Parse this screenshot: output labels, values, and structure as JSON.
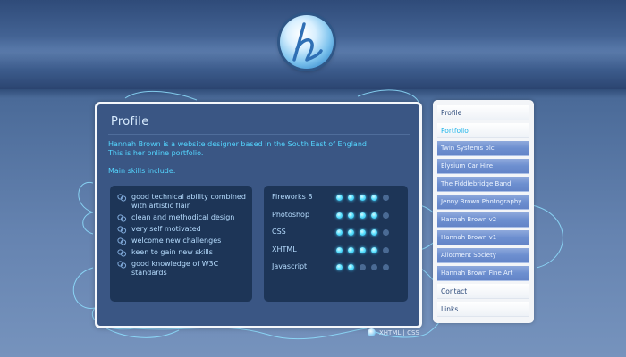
{
  "logo": {
    "letter": "h"
  },
  "panel": {
    "title": "Profile",
    "intro_line1": "Hannah Brown is a website designer based in the South East of England",
    "intro_line2": "This is her online portfolio.",
    "skills_label": "Main skills include:",
    "skills": [
      "good technical ability combined with artistic flair",
      "clean and methodical design",
      "very self motivated",
      "welcome new challenges",
      "keen to gain new skills",
      "good knowledge of W3C standards"
    ],
    "ratings": [
      {
        "label": "Fireworks 8",
        "level": 4,
        "max": 5
      },
      {
        "label": "Photoshop",
        "level": 4,
        "max": 5
      },
      {
        "label": "CSS",
        "level": 4,
        "max": 5
      },
      {
        "label": "XHTML",
        "level": 4,
        "max": 5
      },
      {
        "label": "Javascript",
        "level": 2,
        "max": 5
      }
    ]
  },
  "sidebar": {
    "items": [
      {
        "label": "Profile",
        "kind": "top",
        "active": false
      },
      {
        "label": "Portfolio",
        "kind": "top",
        "active": true
      },
      {
        "label": "Twin Systems plc",
        "kind": "sub"
      },
      {
        "label": "Elysium Car Hire",
        "kind": "sub"
      },
      {
        "label": "The Fiddlebridge Band",
        "kind": "sub"
      },
      {
        "label": "Jenny Brown Photography",
        "kind": "sub"
      },
      {
        "label": "Hannah Brown v2",
        "kind": "sub"
      },
      {
        "label": "Hannah Brown v1",
        "kind": "sub"
      },
      {
        "label": "Allotment Society",
        "kind": "sub"
      },
      {
        "label": "Hannah Brown Fine Art",
        "kind": "sub"
      },
      {
        "label": "Contact",
        "kind": "top",
        "active": false
      },
      {
        "label": "Links",
        "kind": "top",
        "active": false
      }
    ]
  },
  "footer": {
    "validation": "XHTML | CSS"
  },
  "colors": {
    "accent": "#54d6ff",
    "panel": "#3a5684",
    "box": "#1d3557",
    "nav_sub": "#6d8fd0"
  }
}
